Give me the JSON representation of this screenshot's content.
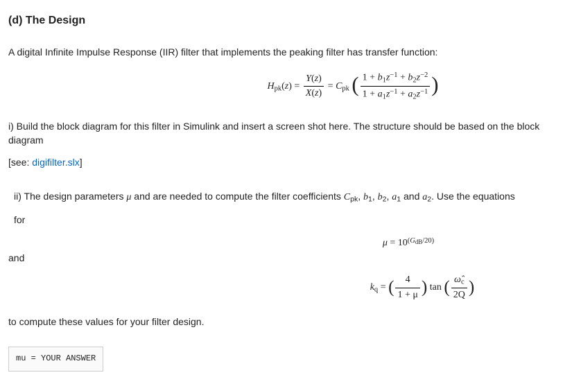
{
  "section": {
    "label": "(d) The Design"
  },
  "intro": "A digital Infinite Impulse Response (IIR) filter that implements the peaking filter has transfer function:",
  "transfer_fn": {
    "lhs_func": "H",
    "lhs_sub": "pk",
    "arg": "z",
    "coef": "C",
    "coef_sub": "pk",
    "num_Y": "Y",
    "den_X": "X",
    "b1": "b",
    "b1_sub": "1",
    "b2": "b",
    "b2_sub": "2",
    "a1": "a",
    "a1_sub": "1",
    "a2": "a",
    "a2_sub": "2"
  },
  "part_i": {
    "text_a": "i) Build the block diagram for this filter in Simulink and insert a screen shot here. The structure should be based on the block diagram",
    "see_prefix": "[see: ",
    "link": "digifilter.slx",
    "see_suffix": "]"
  },
  "part_ii": {
    "lead_a": "ii) The design parameters ",
    "mu": "μ",
    "lead_b": " and  are needed to compute the filter coefficients ",
    "coef_list_1": "C",
    "coef_list_1_sub": "pk",
    "sep1": ", ",
    "coef_list_2": "b",
    "coef_list_2_sub": "1",
    "sep2": ", ",
    "coef_list_3": "b",
    "coef_list_3_sub": "2",
    "sep3": ", ",
    "coef_list_4": "a",
    "coef_list_4_sub": "1",
    "and": " and ",
    "coef_list_5": "a",
    "coef_list_5_sub": "2",
    "trail": ". Use the equations",
    "for_label": "for",
    "and_label": "and",
    "closing": "to compute these values for your filter design."
  },
  "mu_eq": {
    "mu": "μ",
    "eq": " = 10",
    "exp_open": "(",
    "exp_var": "G",
    "exp_sub": "dB",
    "exp_div": "/20",
    "exp_close": ")"
  },
  "kq_eq": {
    "k": "k",
    "k_sub": "q",
    "eq": " = ",
    "four": "4",
    "one_plus_mu": "1 + μ",
    "tan": " tan ",
    "omega_hat": "ω̂",
    "omega_sub": "c",
    "twoQ": "2Q"
  },
  "code": {
    "line1": "mu  =  YOUR  ANSWER"
  }
}
